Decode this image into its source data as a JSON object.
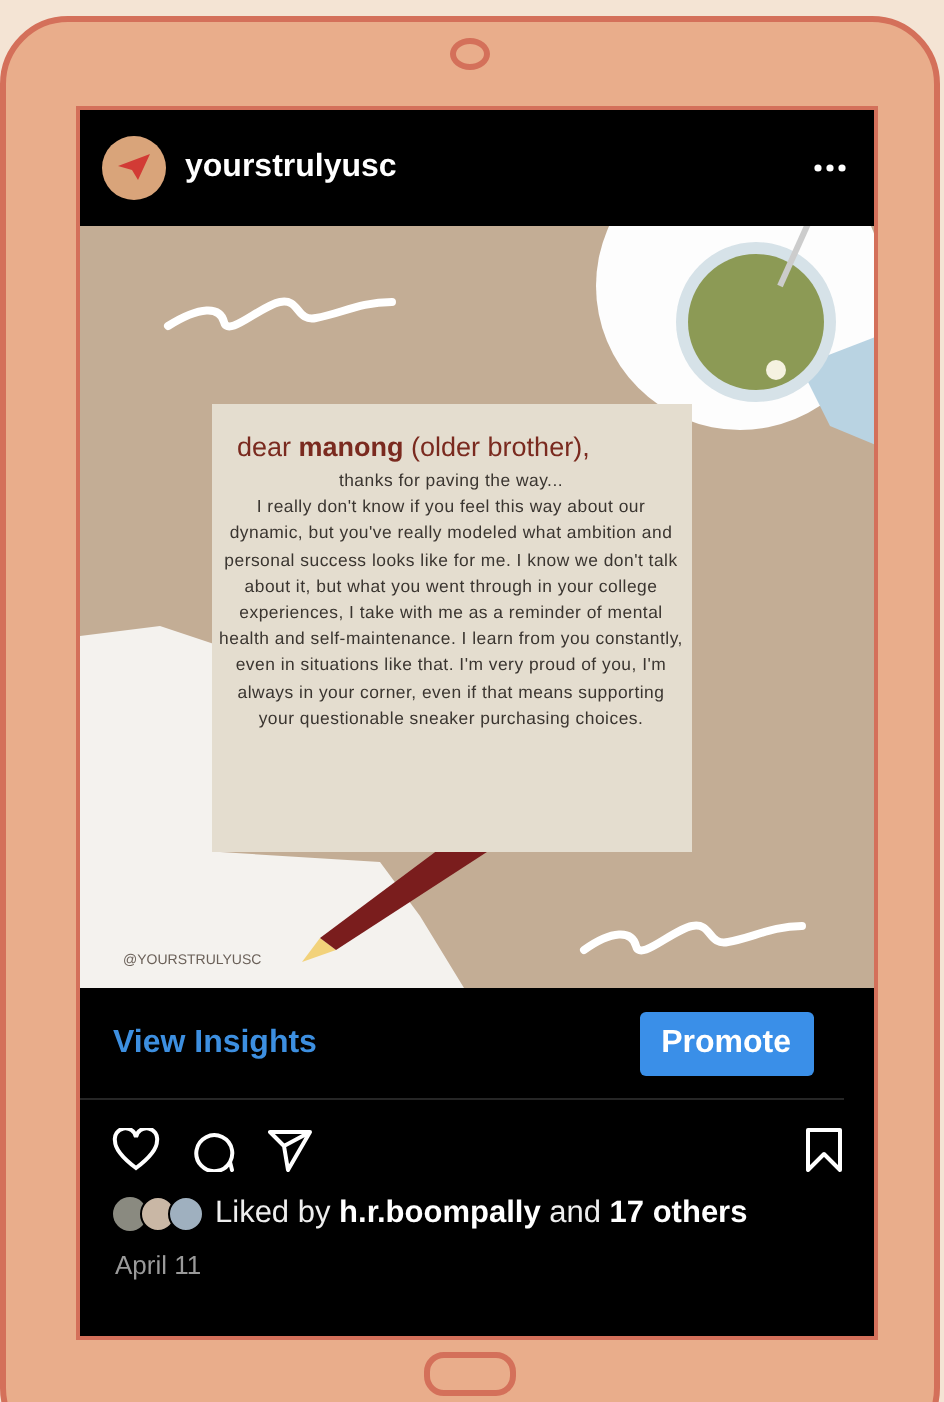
{
  "account": {
    "username": "yourstrulyusc"
  },
  "post_image": {
    "greeting": "dear **manong** (older brother),",
    "intro": "thanks for paving the way...",
    "body": "I really don't know if you feel this way about our dynamic, but you've really modeled what ambition and personal success looks like for me. I know we don't talk about it, but what you went through in your college experiences, I take with me as a reminder of mental health and self-maintenance. I learn from you constantly, even in situations like that. I'm very proud of you, I'm always in your corner, even if that means supporting your questionable sneaker purchasing choices.",
    "handle": "@YOURSTRULYUSC"
  },
  "insights_link": "View Insights",
  "promote_button": "Promote",
  "likes": "Liked by **h.r.boompally** and **17 others**",
  "date": "April 11"
}
